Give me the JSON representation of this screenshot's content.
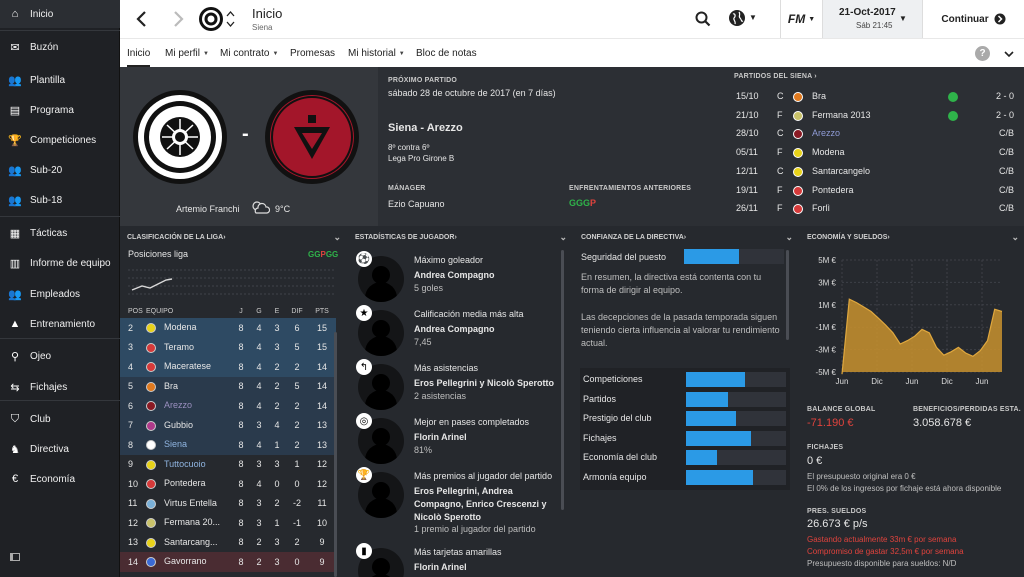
{
  "sidebar": {
    "items": [
      {
        "label": "Inicio",
        "icon": "home-icon"
      },
      {
        "label": "Buzón",
        "icon": "inbox-icon"
      },
      {
        "label": "Plantilla",
        "icon": "squad-icon"
      },
      {
        "label": "Programa",
        "icon": "calendar-icon"
      },
      {
        "label": "Competiciones",
        "icon": "trophy-icon"
      },
      {
        "label": "Sub-20",
        "icon": "team-icon"
      },
      {
        "label": "Sub-18",
        "icon": "team-icon"
      },
      {
        "label": "Tácticas",
        "icon": "tactics-icon"
      },
      {
        "label": "Informe de equipo",
        "icon": "report-icon"
      },
      {
        "label": "Empleados",
        "icon": "staff-icon"
      },
      {
        "label": "Entrenamiento",
        "icon": "training-icon"
      },
      {
        "label": "Ojeo",
        "icon": "scouting-icon"
      },
      {
        "label": "Fichajes",
        "icon": "transfers-icon"
      },
      {
        "label": "Club",
        "icon": "club-icon"
      },
      {
        "label": "Directiva",
        "icon": "board-icon"
      },
      {
        "label": "Economía",
        "icon": "finance-icon"
      }
    ]
  },
  "topbar": {
    "title": "Inicio",
    "subtitle": "Siena",
    "date": "21-Oct-2017",
    "time": "Sáb 21:45",
    "continue_label": "Continuar",
    "fm_logo": "FM"
  },
  "subnav": {
    "tabs": [
      "Inicio",
      "Mi perfil",
      "Mi contrato",
      "Promesas",
      "Mi historial",
      "Bloc de notas"
    ],
    "help": "?"
  },
  "next_match": {
    "label": "PRÓXIMO PARTIDO",
    "date": "sábado 28 de octubre de 2017 (en 7 días)",
    "fixture": "Siena - Arezzo",
    "position": "8º contra 6º",
    "competition": "Lega Pro Girone B",
    "stadium": "Artemio Franchi",
    "temperature": "9°C",
    "vs": "-",
    "manager_label": "MÁNAGER",
    "manager": "Ezio Capuano",
    "previous_label": "ENFRENTAMIENTOS ANTERIORES",
    "previous": [
      {
        "r": "G",
        "c": "#2fb34a"
      },
      {
        "r": "G",
        "c": "#2fb34a"
      },
      {
        "r": "G",
        "c": "#2fb34a"
      },
      {
        "r": "P",
        "c": "#e0433d"
      }
    ]
  },
  "fixtures": {
    "title": "PARTIDOS DEL SIENA",
    "rows": [
      {
        "date": "15/10",
        "venue": "C",
        "team": "Bra",
        "crest": "#e07a1f",
        "result": "2 - 0",
        "dot": true,
        "highlight": false
      },
      {
        "date": "21/10",
        "venue": "F",
        "team": "Fermana 2013",
        "crest": "#c9c26a",
        "result": "2 - 0",
        "dot": true,
        "highlight": false
      },
      {
        "date": "28/10",
        "venue": "C",
        "team": "Arezzo",
        "crest": "#8b1a24",
        "result": "C/B",
        "dot": false,
        "highlight": true
      },
      {
        "date": "05/11",
        "venue": "F",
        "team": "Modena",
        "crest": "#e8d21a",
        "result": "C/B",
        "dot": false,
        "highlight": false
      },
      {
        "date": "12/11",
        "venue": "C",
        "team": "Santarcangelo",
        "crest": "#e8d21a",
        "result": "C/B",
        "dot": false,
        "highlight": false
      },
      {
        "date": "19/11",
        "venue": "F",
        "team": "Pontedera",
        "crest": "#d63a3a",
        "result": "C/B",
        "dot": false,
        "highlight": false
      },
      {
        "date": "26/11",
        "venue": "F",
        "team": "Forlì",
        "crest": "#d63a3a",
        "result": "C/B",
        "dot": false,
        "highlight": false
      }
    ]
  },
  "league": {
    "title": "CLASIFICACIÓN DE LA LIGA",
    "positions_label": "Posiciones liga",
    "form": [
      {
        "r": "G",
        "c": "#2fb34a"
      },
      {
        "r": "G",
        "c": "#2fb34a"
      },
      {
        "r": "P",
        "c": "#e0433d"
      },
      {
        "r": "G",
        "c": "#2fb34a"
      },
      {
        "r": "G",
        "c": "#2fb34a"
      }
    ],
    "headers": [
      "POS",
      "EQUIPO",
      "J",
      "G",
      "E",
      "DIF",
      "PTS"
    ],
    "rows": [
      {
        "pos": "2",
        "team": "Modena",
        "j": "8",
        "g": "4",
        "e": "3",
        "dif": "6",
        "pts": "15",
        "crest": "#e8d21a",
        "style": "normal",
        "bg": "#2e4a63"
      },
      {
        "pos": "3",
        "team": "Teramo",
        "j": "8",
        "g": "4",
        "e": "3",
        "dif": "5",
        "pts": "15",
        "crest": "#d63a3a",
        "style": "normal",
        "bg": "#2e4a63"
      },
      {
        "pos": "4",
        "team": "Maceratese",
        "j": "8",
        "g": "4",
        "e": "2",
        "dif": "2",
        "pts": "14",
        "crest": "#d63a3a",
        "style": "normal",
        "bg": "#2e4a63"
      },
      {
        "pos": "5",
        "team": "Bra",
        "j": "8",
        "g": "4",
        "e": "2",
        "dif": "5",
        "pts": "14",
        "crest": "#e07a1f",
        "style": "normal",
        "bg": "#2a3a4c"
      },
      {
        "pos": "6",
        "team": "Arezzo",
        "j": "8",
        "g": "4",
        "e": "2",
        "dif": "2",
        "pts": "14",
        "crest": "#8b1a24",
        "style": "muted",
        "bg": "#2a3a4c"
      },
      {
        "pos": "7",
        "team": "Gubbio",
        "j": "8",
        "g": "3",
        "e": "4",
        "dif": "2",
        "pts": "13",
        "crest": "#b03a8a",
        "style": "normal",
        "bg": "#2a3a4c"
      },
      {
        "pos": "8",
        "team": "Siena",
        "j": "8",
        "g": "4",
        "e": "1",
        "dif": "2",
        "pts": "13",
        "crest": "#ffffff",
        "style": "highlight",
        "bg": "#2a3a4c"
      },
      {
        "pos": "9",
        "team": "Tuttocuoio",
        "j": "8",
        "g": "3",
        "e": "3",
        "dif": "1",
        "pts": "12",
        "crest": "#e8d21a",
        "style": "highlight",
        "bg": "none"
      },
      {
        "pos": "10",
        "team": "Pontedera",
        "j": "8",
        "g": "4",
        "e": "0",
        "dif": "0",
        "pts": "12",
        "crest": "#d63a3a",
        "style": "normal",
        "bg": "none"
      },
      {
        "pos": "11",
        "team": "Virtus Entella",
        "j": "8",
        "g": "3",
        "e": "2",
        "dif": "-2",
        "pts": "11",
        "crest": "#7ab0d8",
        "style": "normal",
        "bg": "none"
      },
      {
        "pos": "12",
        "team": "Fermana 20...",
        "j": "8",
        "g": "3",
        "e": "1",
        "dif": "-1",
        "pts": "10",
        "crest": "#c9c26a",
        "style": "normal",
        "bg": "none"
      },
      {
        "pos": "13",
        "team": "Santarcang...",
        "j": "8",
        "g": "2",
        "e": "3",
        "dif": "2",
        "pts": "9",
        "crest": "#e8d21a",
        "style": "normal",
        "bg": "none"
      },
      {
        "pos": "14",
        "team": "Gavorrano",
        "j": "8",
        "g": "2",
        "e": "3",
        "dif": "0",
        "pts": "9",
        "crest": "#3a6ad6",
        "style": "normal",
        "bg": "#4a2c32"
      }
    ]
  },
  "player_stats": {
    "title": "ESTADÍSTICAS DE JUGADOR",
    "items": [
      {
        "category": "Máximo goleador",
        "player": "Andrea Compagno",
        "detail": "5 goles",
        "badge": "⚽"
      },
      {
        "category": "Calificación media más alta",
        "player": "Andrea Compagno",
        "detail": "7,45",
        "badge": "★"
      },
      {
        "category": "Más asistencias",
        "player": "Eros Pellegrini y Nicolò Sperotto",
        "detail": "2 asistencias",
        "badge": "↰"
      },
      {
        "category": "Mejor en pases completados",
        "player": "Florin Arinel",
        "detail": "81%",
        "badge": "◎"
      },
      {
        "category": "Más premios al jugador del partido",
        "player": "Eros Pellegrini, Andrea Compagno, Enrico Crescenzi y Nicolò Sperotto",
        "detail": "1 premio al jugador del partido",
        "badge": "🏆"
      },
      {
        "category": "Más tarjetas amarillas",
        "player": "Florin Arinel",
        "detail": "",
        "badge": "▮"
      }
    ]
  },
  "board": {
    "title": "CONFIANZA DE LA DIRECTIVA",
    "job_security_label": "Seguridad del puesto",
    "job_security": 0.55,
    "summary": "En resumen, la directiva está contenta con tu forma de dirigir al equipo.",
    "note": "Las decepciones de la pasada temporada siguen teniendo cierta influencia al valorar tu rendimiento actual.",
    "areas": [
      {
        "label": "Competiciones",
        "value": 0.59
      },
      {
        "label": "Partidos",
        "value": 0.42
      },
      {
        "label": "Prestigio del club",
        "value": 0.5
      },
      {
        "label": "Fichajes",
        "value": 0.65
      },
      {
        "label": "Economía del club",
        "value": 0.31
      },
      {
        "label": "Armonía equipo",
        "value": 0.67
      }
    ]
  },
  "finance": {
    "title": "ECONOMÍA Y SUELDOS",
    "chart_data": {
      "type": "area",
      "ylim": [
        -5,
        5
      ],
      "yticks": [
        "5M €",
        "3M €",
        "1M €",
        "-1M €",
        "-3M €",
        "-5M €"
      ],
      "xticks": [
        "Jun",
        "Dic",
        "Jun",
        "Dic",
        "Jun"
      ],
      "values": [
        -5.2,
        1.5,
        1.2,
        0.8,
        0.4,
        -0.2,
        -0.8,
        -1.5,
        -2.5,
        -2.2,
        -1.8,
        -1.2,
        -1.5,
        -2.8,
        -3.5,
        -3.2,
        -2.8,
        -3.3,
        -3.6,
        -3.1,
        -2.2,
        0.6,
        0.4
      ],
      "color": "#c9922e"
    },
    "balance_label": "BALANCE GLOBAL",
    "balance": "-71.190 €",
    "profit_label": "BENEFICIOS/PÉRDIDAS ESTA...",
    "profit": "3.058.678 €",
    "transfers_label": "FICHAJES",
    "transfers": "0 €",
    "transfers_note1": "El presupuesto original era 0 €",
    "transfers_note2": "El 0% de los ingresos por fichaje está ahora disponible",
    "wages_label": "PRES. SUELDOS",
    "wages": "26.673 € p/s",
    "wages_note1": "Gastando actualmente 33m € por semana",
    "wages_note2": "Compromiso de gastar 32,5m € por semana",
    "wages_note3": "Presupuesto disponible para sueldos: N/D"
  },
  "colors": {
    "accent": "#2b9ae6",
    "win": "#2fb34a",
    "loss": "#e0433d",
    "home_crest": "#ffffff",
    "away_crest": "#a3162a"
  }
}
